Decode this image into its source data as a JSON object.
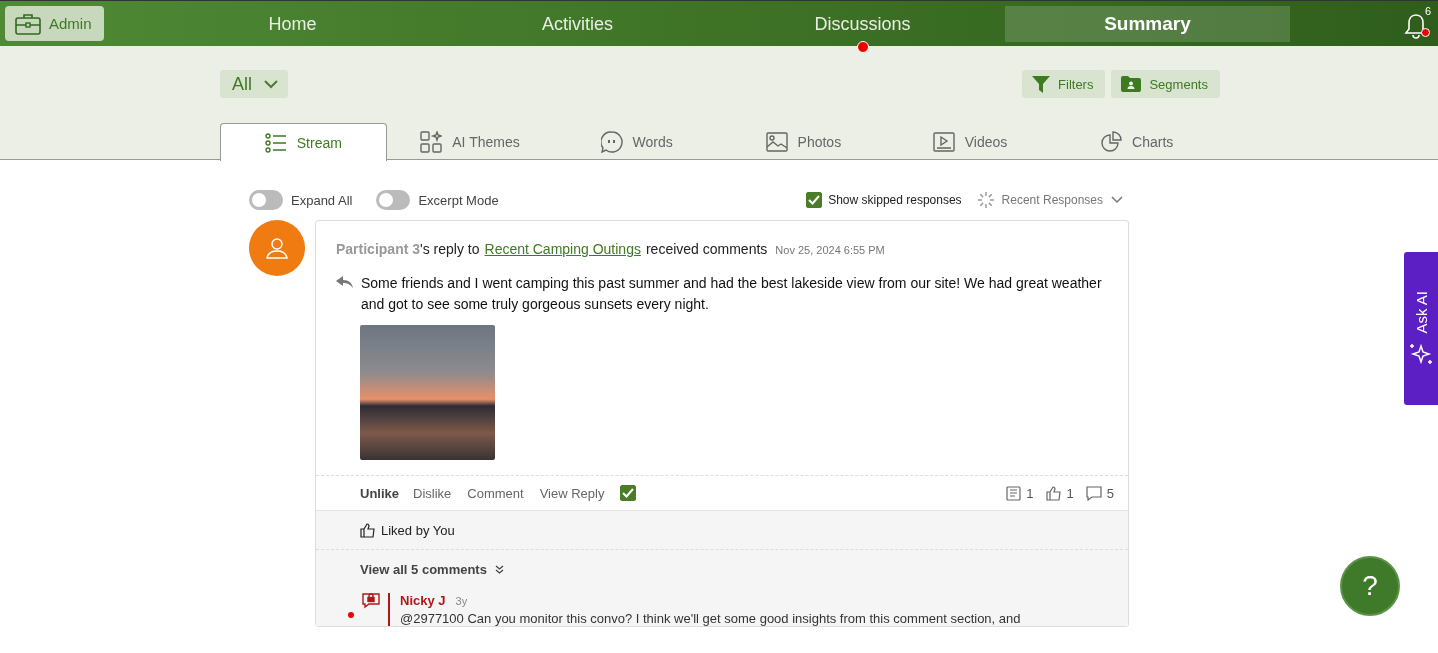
{
  "admin_button": {
    "label": "Admin"
  },
  "nav": [
    {
      "label": "Home",
      "selected": false,
      "notification": false
    },
    {
      "label": "Activities",
      "selected": false,
      "notification": false
    },
    {
      "label": "Discussions",
      "selected": false,
      "notification": true
    },
    {
      "label": "Summary",
      "selected": true,
      "notification": false
    }
  ],
  "notifications": {
    "count": "6",
    "unread": true
  },
  "filter_dropdown": {
    "value": "All"
  },
  "tool_buttons": [
    {
      "kind": "filter",
      "label": "Filters"
    },
    {
      "kind": "segment",
      "label": "Segments"
    }
  ],
  "tabs": [
    {
      "kind": "stream",
      "label": "Stream",
      "selected": true
    },
    {
      "kind": "themes",
      "label": "AI Themes",
      "selected": false
    },
    {
      "kind": "words",
      "label": "Words",
      "selected": false
    },
    {
      "kind": "photos",
      "label": "Photos",
      "selected": false
    },
    {
      "kind": "videos",
      "label": "Videos",
      "selected": false
    },
    {
      "kind": "charts",
      "label": "Charts",
      "selected": false
    }
  ],
  "toggles": [
    {
      "label": "Expand All",
      "on": false
    },
    {
      "label": "Excerpt Mode",
      "on": false
    }
  ],
  "show_skipped": {
    "label": "Show skipped responses",
    "checked": true
  },
  "sort_dropdown": {
    "value": "Recent Responses"
  },
  "post": {
    "participant": "Participant 3",
    "reply_to_text": "'s reply to",
    "topic_link": "Recent Camping Outings",
    "suffix": "received comments",
    "date": "Nov 25, 2024 6:55 PM",
    "body": "Some friends and I went camping this past summer and had the best lakeside view from our site! We had great weather and got to see some truly gorgeous sunsets every night.",
    "actions": [
      "Unlike",
      "Dislike",
      "Comment",
      "View Reply"
    ],
    "reviewed": true,
    "stats": [
      {
        "kind": "notes",
        "count": "1"
      },
      {
        "kind": "likes",
        "count": "1"
      },
      {
        "kind": "comments",
        "count": "5"
      }
    ],
    "liked_by": "Liked by You",
    "view_all": "View all 5 comments",
    "comments": [
      {
        "author": "Nicky J",
        "age": "3y",
        "unread": true,
        "text": "@2977100 Can you monitor this convo? I think we'll get some good insights from this comment section, and"
      }
    ]
  },
  "ask_ai": {
    "label": "Ask AI"
  },
  "help_button": {
    "label": "?"
  }
}
